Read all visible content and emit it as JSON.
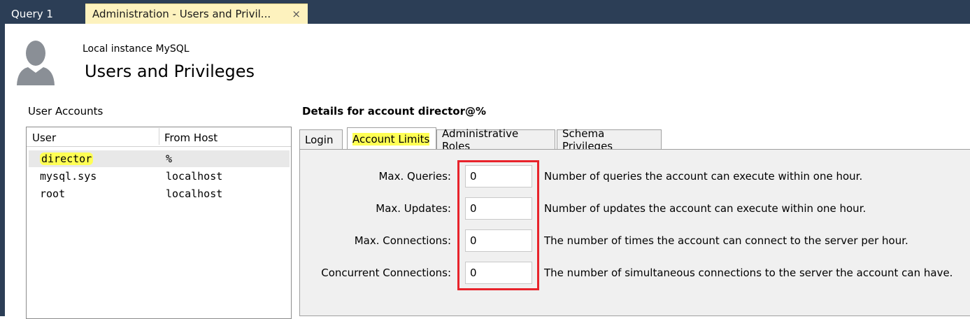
{
  "tabs": {
    "query": "Query 1",
    "admin": "Administration - Users and Privil...",
    "close_glyph": "×"
  },
  "header": {
    "subtitle": "Local instance MySQL",
    "title": "Users and Privileges",
    "avatar_icon": "user-silhouette-icon"
  },
  "accounts": {
    "label": "User Accounts",
    "columns": [
      "User",
      "From Host"
    ],
    "rows": [
      {
        "user": "director",
        "host": "%",
        "selected": true
      },
      {
        "user": "mysql.sys",
        "host": "localhost"
      },
      {
        "user": "root",
        "host": "localhost"
      }
    ]
  },
  "details": {
    "title": "Details for account director@%",
    "tabs": [
      "Login",
      "Account Limits",
      "Administrative Roles",
      "Schema Privileges"
    ],
    "active_tab": "Account Limits",
    "fields": [
      {
        "label": "Max. Queries:",
        "value": "0",
        "description": "Number of queries the account can execute within one hour."
      },
      {
        "label": "Max. Updates:",
        "value": "0",
        "description": "Number of updates the account can execute within one hour."
      },
      {
        "label": "Max. Connections:",
        "value": "0",
        "description": "The number of times the account can connect to the server per hour."
      },
      {
        "label": "Concurrent Connections:",
        "value": "0",
        "description": "The number of simultaneous connections to the server the account can have."
      }
    ]
  },
  "colors": {
    "tabbar": "#2c3e56",
    "active_doc_tab": "#fdf2be",
    "highlight": "#ffff55",
    "annotation_red": "#e8232b"
  }
}
